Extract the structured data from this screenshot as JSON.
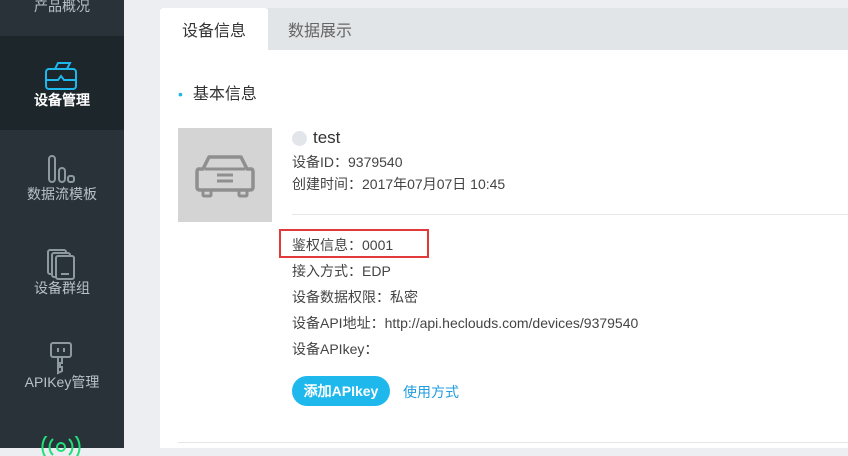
{
  "sidebar": {
    "items": [
      {
        "label": "产品概况",
        "icon": "overview-icon"
      },
      {
        "label": "设备管理",
        "icon": "device-management-icon",
        "active": true
      },
      {
        "label": "数据流模板",
        "icon": "datastream-template-icon"
      },
      {
        "label": "设备群组",
        "icon": "device-group-icon"
      },
      {
        "label": "APIKey管理",
        "icon": "apikey-icon"
      },
      {
        "label": "",
        "icon": "signal-icon"
      }
    ]
  },
  "tabs": [
    {
      "label": "设备信息",
      "active": true
    },
    {
      "label": "数据展示",
      "active": false
    }
  ],
  "section": {
    "title": "基本信息"
  },
  "device": {
    "name": "test",
    "id_line": "设备ID：9379540",
    "created_line": "创建时间：2017年07月07日 10:45",
    "auth_line": "鉴权信息：0001",
    "protocol_line": "接入方式：EDP",
    "permission_line": "设备数据权限：私密",
    "api_line": "设备API地址：http://api.heclouds.com/devices/9379540",
    "apikey_line": "设备APIkey："
  },
  "actions": {
    "add_apikey_label": "添加APIkey",
    "usage_link_label": "使用方式"
  },
  "colors": {
    "sidebar_bg": "#283238",
    "accent": "#1fb8ec",
    "highlight": "#e23a3a"
  }
}
